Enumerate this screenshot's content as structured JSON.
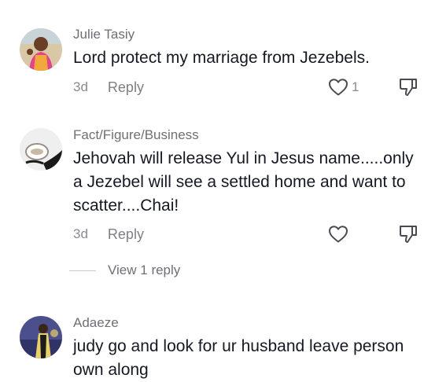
{
  "comments": [
    {
      "author": "Julie Tasiy",
      "text": "Lord protect my marriage from Jezebels.",
      "time": "3d",
      "reply_label": "Reply",
      "like_count": "1"
    },
    {
      "author": "Fact/Figure/Business",
      "text": "Jehovah will release Yul in Jesus name.....only a Jezebel will see a settled home and want to scatter....Chai!",
      "time": "3d",
      "reply_label": "Reply",
      "like_count": ""
    },
    {
      "author": "Adaeze",
      "text": "judy go and look for ur husband leave person own along"
    }
  ],
  "view_replies_label": "View 1 reply",
  "icons": [
    "heart-outline-icon",
    "thumbs-down-icon"
  ],
  "colors": {
    "text": "#161823",
    "secondary": "#8a8b91",
    "icon": "#4a4b52",
    "background": "#ffffff"
  }
}
